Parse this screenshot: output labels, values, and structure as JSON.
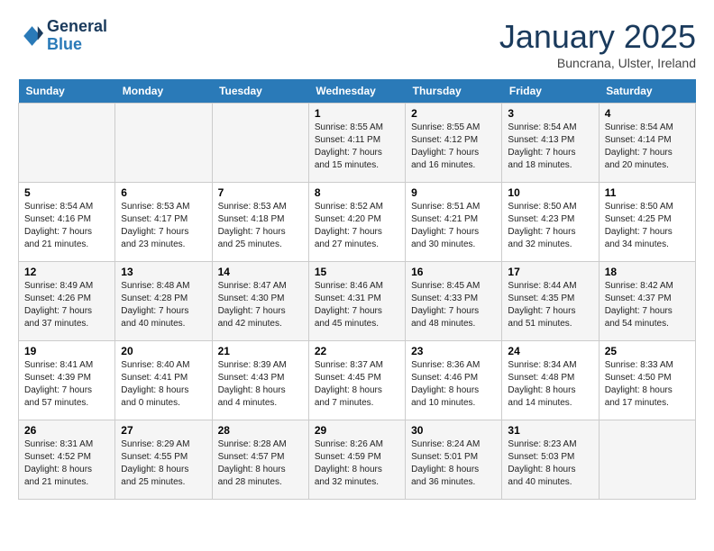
{
  "header": {
    "logo_line1": "General",
    "logo_line2": "Blue",
    "month": "January 2025",
    "location": "Buncrana, Ulster, Ireland"
  },
  "weekdays": [
    "Sunday",
    "Monday",
    "Tuesday",
    "Wednesday",
    "Thursday",
    "Friday",
    "Saturday"
  ],
  "weeks": [
    [
      {
        "day": "",
        "info": ""
      },
      {
        "day": "",
        "info": ""
      },
      {
        "day": "",
        "info": ""
      },
      {
        "day": "1",
        "info": "Sunrise: 8:55 AM\nSunset: 4:11 PM\nDaylight: 7 hours\nand 15 minutes."
      },
      {
        "day": "2",
        "info": "Sunrise: 8:55 AM\nSunset: 4:12 PM\nDaylight: 7 hours\nand 16 minutes."
      },
      {
        "day": "3",
        "info": "Sunrise: 8:54 AM\nSunset: 4:13 PM\nDaylight: 7 hours\nand 18 minutes."
      },
      {
        "day": "4",
        "info": "Sunrise: 8:54 AM\nSunset: 4:14 PM\nDaylight: 7 hours\nand 20 minutes."
      }
    ],
    [
      {
        "day": "5",
        "info": "Sunrise: 8:54 AM\nSunset: 4:16 PM\nDaylight: 7 hours\nand 21 minutes."
      },
      {
        "day": "6",
        "info": "Sunrise: 8:53 AM\nSunset: 4:17 PM\nDaylight: 7 hours\nand 23 minutes."
      },
      {
        "day": "7",
        "info": "Sunrise: 8:53 AM\nSunset: 4:18 PM\nDaylight: 7 hours\nand 25 minutes."
      },
      {
        "day": "8",
        "info": "Sunrise: 8:52 AM\nSunset: 4:20 PM\nDaylight: 7 hours\nand 27 minutes."
      },
      {
        "day": "9",
        "info": "Sunrise: 8:51 AM\nSunset: 4:21 PM\nDaylight: 7 hours\nand 30 minutes."
      },
      {
        "day": "10",
        "info": "Sunrise: 8:50 AM\nSunset: 4:23 PM\nDaylight: 7 hours\nand 32 minutes."
      },
      {
        "day": "11",
        "info": "Sunrise: 8:50 AM\nSunset: 4:25 PM\nDaylight: 7 hours\nand 34 minutes."
      }
    ],
    [
      {
        "day": "12",
        "info": "Sunrise: 8:49 AM\nSunset: 4:26 PM\nDaylight: 7 hours\nand 37 minutes."
      },
      {
        "day": "13",
        "info": "Sunrise: 8:48 AM\nSunset: 4:28 PM\nDaylight: 7 hours\nand 40 minutes."
      },
      {
        "day": "14",
        "info": "Sunrise: 8:47 AM\nSunset: 4:30 PM\nDaylight: 7 hours\nand 42 minutes."
      },
      {
        "day": "15",
        "info": "Sunrise: 8:46 AM\nSunset: 4:31 PM\nDaylight: 7 hours\nand 45 minutes."
      },
      {
        "day": "16",
        "info": "Sunrise: 8:45 AM\nSunset: 4:33 PM\nDaylight: 7 hours\nand 48 minutes."
      },
      {
        "day": "17",
        "info": "Sunrise: 8:44 AM\nSunset: 4:35 PM\nDaylight: 7 hours\nand 51 minutes."
      },
      {
        "day": "18",
        "info": "Sunrise: 8:42 AM\nSunset: 4:37 PM\nDaylight: 7 hours\nand 54 minutes."
      }
    ],
    [
      {
        "day": "19",
        "info": "Sunrise: 8:41 AM\nSunset: 4:39 PM\nDaylight: 7 hours\nand 57 minutes."
      },
      {
        "day": "20",
        "info": "Sunrise: 8:40 AM\nSunset: 4:41 PM\nDaylight: 8 hours\nand 0 minutes."
      },
      {
        "day": "21",
        "info": "Sunrise: 8:39 AM\nSunset: 4:43 PM\nDaylight: 8 hours\nand 4 minutes."
      },
      {
        "day": "22",
        "info": "Sunrise: 8:37 AM\nSunset: 4:45 PM\nDaylight: 8 hours\nand 7 minutes."
      },
      {
        "day": "23",
        "info": "Sunrise: 8:36 AM\nSunset: 4:46 PM\nDaylight: 8 hours\nand 10 minutes."
      },
      {
        "day": "24",
        "info": "Sunrise: 8:34 AM\nSunset: 4:48 PM\nDaylight: 8 hours\nand 14 minutes."
      },
      {
        "day": "25",
        "info": "Sunrise: 8:33 AM\nSunset: 4:50 PM\nDaylight: 8 hours\nand 17 minutes."
      }
    ],
    [
      {
        "day": "26",
        "info": "Sunrise: 8:31 AM\nSunset: 4:52 PM\nDaylight: 8 hours\nand 21 minutes."
      },
      {
        "day": "27",
        "info": "Sunrise: 8:29 AM\nSunset: 4:55 PM\nDaylight: 8 hours\nand 25 minutes."
      },
      {
        "day": "28",
        "info": "Sunrise: 8:28 AM\nSunset: 4:57 PM\nDaylight: 8 hours\nand 28 minutes."
      },
      {
        "day": "29",
        "info": "Sunrise: 8:26 AM\nSunset: 4:59 PM\nDaylight: 8 hours\nand 32 minutes."
      },
      {
        "day": "30",
        "info": "Sunrise: 8:24 AM\nSunset: 5:01 PM\nDaylight: 8 hours\nand 36 minutes."
      },
      {
        "day": "31",
        "info": "Sunrise: 8:23 AM\nSunset: 5:03 PM\nDaylight: 8 hours\nand 40 minutes."
      },
      {
        "day": "",
        "info": ""
      }
    ]
  ]
}
